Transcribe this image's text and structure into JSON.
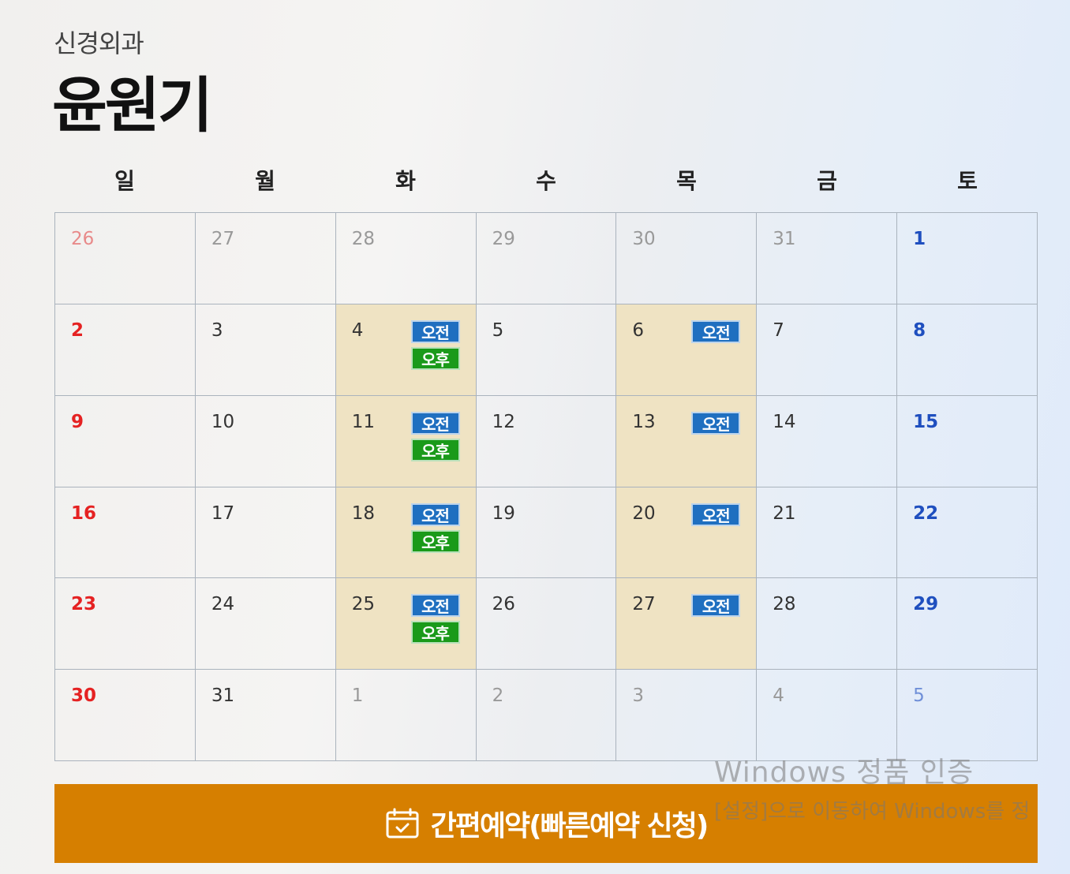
{
  "header": {
    "department": "신경외과",
    "doctor_name": "윤원기"
  },
  "weekdays": [
    "일",
    "월",
    "화",
    "수",
    "목",
    "금",
    "토"
  ],
  "calendar": {
    "weeks": [
      [
        {
          "day": "26",
          "other": true
        },
        {
          "day": "27",
          "other": true
        },
        {
          "day": "28",
          "other": true
        },
        {
          "day": "29",
          "other": true
        },
        {
          "day": "30",
          "other": true
        },
        {
          "day": "31",
          "other": true
        },
        {
          "day": "1",
          "other": false
        }
      ],
      [
        {
          "day": "2",
          "other": false
        },
        {
          "day": "3",
          "other": false
        },
        {
          "day": "4",
          "other": false,
          "slots": [
            "오전",
            "오후"
          ]
        },
        {
          "day": "5",
          "other": false
        },
        {
          "day": "6",
          "other": false,
          "slots": [
            "오전"
          ]
        },
        {
          "day": "7",
          "other": false
        },
        {
          "day": "8",
          "other": false
        }
      ],
      [
        {
          "day": "9",
          "other": false
        },
        {
          "day": "10",
          "other": false
        },
        {
          "day": "11",
          "other": false,
          "slots": [
            "오전",
            "오후"
          ]
        },
        {
          "day": "12",
          "other": false
        },
        {
          "day": "13",
          "other": false,
          "slots": [
            "오전"
          ]
        },
        {
          "day": "14",
          "other": false
        },
        {
          "day": "15",
          "other": false
        }
      ],
      [
        {
          "day": "16",
          "other": false
        },
        {
          "day": "17",
          "other": false
        },
        {
          "day": "18",
          "other": false,
          "slots": [
            "오전",
            "오후"
          ]
        },
        {
          "day": "19",
          "other": false
        },
        {
          "day": "20",
          "other": false,
          "slots": [
            "오전"
          ]
        },
        {
          "day": "21",
          "other": false
        },
        {
          "day": "22",
          "other": false
        }
      ],
      [
        {
          "day": "23",
          "other": false
        },
        {
          "day": "24",
          "other": false
        },
        {
          "day": "25",
          "other": false,
          "slots": [
            "오전",
            "오후"
          ]
        },
        {
          "day": "26",
          "other": false
        },
        {
          "day": "27",
          "other": false,
          "slots": [
            "오전"
          ]
        },
        {
          "day": "28",
          "other": false
        },
        {
          "day": "29",
          "other": false
        }
      ],
      [
        {
          "day": "30",
          "other": false
        },
        {
          "day": "31",
          "other": false
        },
        {
          "day": "1",
          "other": true
        },
        {
          "day": "2",
          "other": true
        },
        {
          "day": "3",
          "other": true
        },
        {
          "day": "4",
          "other": true
        },
        {
          "day": "5",
          "other": true
        }
      ]
    ]
  },
  "colors": {
    "am_badge": "#1f6fc0",
    "pm_badge": "#1a9a1a",
    "available_cell": "#efe3c3",
    "sunday": "#e52222",
    "saturday": "#1f4fbf",
    "reserve_button": "#d67f00"
  },
  "reserve_button": {
    "icon": "calendar-check-icon",
    "label": "간편예약(빠른예약 신청)"
  },
  "watermark": {
    "title": "Windows 정품 인증",
    "subtitle": "[설정]으로 이동하여 Windows를 정"
  }
}
